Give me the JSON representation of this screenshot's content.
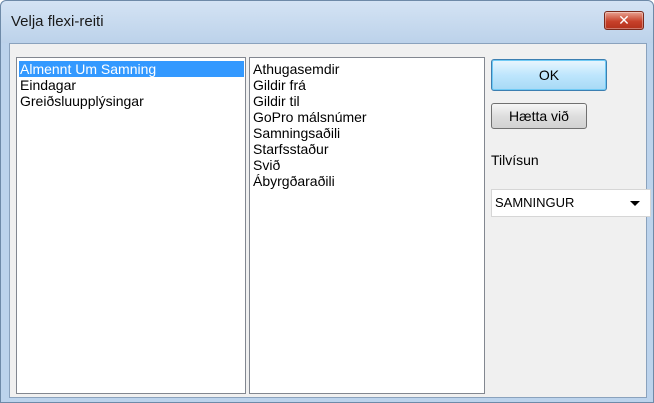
{
  "window": {
    "title": "Velja flexi-reiti",
    "close_glyph": "✕"
  },
  "left_list": {
    "items": [
      {
        "label": "Almennt Um Samning",
        "selected": true
      },
      {
        "label": "Eindagar",
        "selected": false
      },
      {
        "label": "Greiðsluupplýsingar",
        "selected": false
      }
    ]
  },
  "middle_list": {
    "items": [
      {
        "label": "Athugasemdir"
      },
      {
        "label": "Gildir frá"
      },
      {
        "label": "Gildir til"
      },
      {
        "label": "GoPro málsnúmer"
      },
      {
        "label": "Samningsaðili"
      },
      {
        "label": "Starfsstaður"
      },
      {
        "label": "Svið"
      },
      {
        "label": "Ábyrgðaraðili"
      }
    ]
  },
  "buttons": {
    "ok_label": "OK",
    "cancel_label": "Hætta við"
  },
  "tilvisun": {
    "label": "Tilvísun",
    "selected_value": "SAMNINGUR"
  },
  "colors": {
    "selection": "#3399ff",
    "close_button": "#c7412a",
    "frame": "#bcd3ec"
  }
}
